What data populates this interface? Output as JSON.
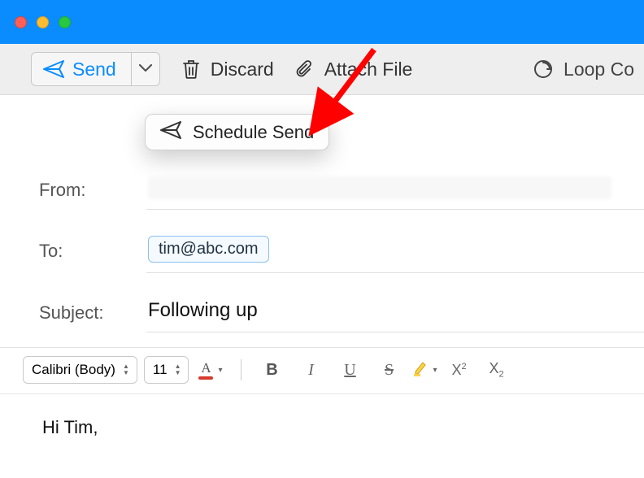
{
  "toolbar": {
    "send_label": "Send",
    "discard_label": "Discard",
    "attach_label": "Attach File",
    "loop_label": "Loop Co",
    "dropdown_item": "Schedule Send"
  },
  "fields": {
    "from_label": "From:",
    "to_label": "To:",
    "to_value": "tim@abc.com",
    "subject_label": "Subject:",
    "subject_value": "Following up"
  },
  "format": {
    "font_name": "Calibri (Body)",
    "font_size": "11",
    "font_color": "#d63a2d",
    "highlight_color": "#ffd24a"
  },
  "body": {
    "line1": "Hi Tim,"
  }
}
